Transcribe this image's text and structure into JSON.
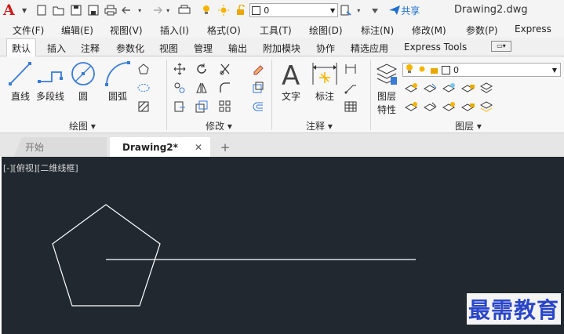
{
  "qat": {
    "logo": "A",
    "layer_value": "0",
    "share_label": "共享",
    "doc_title": "Drawing2.dwg"
  },
  "menu": [
    "文件(F)",
    "编辑(E)",
    "视图(V)",
    "插入(I)",
    "格式(O)",
    "工具(T)",
    "绘图(D)",
    "标注(N)",
    "修改(M)",
    "参数(P)",
    "Express"
  ],
  "ribbon_tabs": [
    "默认",
    "插入",
    "注释",
    "参数化",
    "视图",
    "管理",
    "输出",
    "附加模块",
    "协作",
    "精选应用",
    "Express Tools"
  ],
  "ribbon": {
    "draw": {
      "line": "直线",
      "polyline": "多段线",
      "circle": "圆",
      "arc": "圆弧",
      "title": "绘图"
    },
    "modify": {
      "title": "修改"
    },
    "annotation": {
      "text": "文字",
      "dimension": "标注",
      "title": "注释"
    },
    "layers": {
      "properties_line1": "图层",
      "properties_line2": "特性",
      "layer_value": "0",
      "title": "图层"
    }
  },
  "doc_tabs": {
    "start": "开始",
    "active": "Drawing2*",
    "close": "✕",
    "add": "+"
  },
  "canvas": {
    "view_label": "[-][俯视][二维线框]",
    "watermark": "最需教育",
    "colors": {
      "background": "#212830",
      "lines": "#ffffff"
    }
  }
}
